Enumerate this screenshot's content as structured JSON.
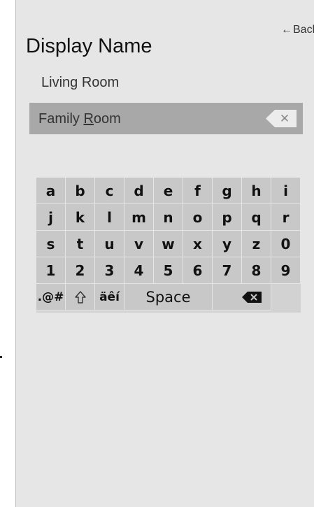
{
  "header": {
    "back_label": "Back",
    "back_icon": "left-arrow-icon",
    "title": "Display Name"
  },
  "options": {
    "current": "Living Room"
  },
  "input": {
    "text_before": "Family ",
    "text_cursor_char": "R",
    "text_after": "oom",
    "clear_icon": "close-icon"
  },
  "keyboard": {
    "rows": [
      [
        "a",
        "b",
        "c",
        "d",
        "e",
        "f",
        "g",
        "h",
        "i"
      ],
      [
        "j",
        "k",
        "l",
        "m",
        "n",
        "o",
        "p",
        "q",
        "r"
      ],
      [
        "s",
        "t",
        "u",
        "v",
        "w",
        "x",
        "y",
        "z",
        "0"
      ],
      [
        "1",
        "2",
        "3",
        "4",
        "5",
        "6",
        "7",
        "8",
        "9"
      ]
    ],
    "symbols_label": ".@#",
    "shift_icon": "shift-arrow-icon",
    "accents_label": "äêí",
    "space_label": "Space",
    "backspace_icon": "backspace-icon"
  }
}
